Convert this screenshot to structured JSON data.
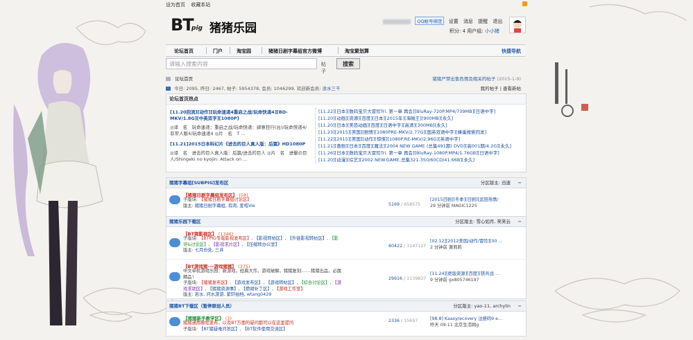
{
  "topbar": {
    "set_home": "设为首页",
    "bookmark": "收藏本站"
  },
  "logo": {
    "bt": "BT",
    "pig": "pig",
    "name": "猪猪乐园"
  },
  "user": {
    "qq_bind": "QQ帐号绑定",
    "links": [
      "设置",
      "消息",
      "提醒",
      "退出"
    ],
    "points": "积分: 4",
    "group_label": "用户组:",
    "group": "小小猪"
  },
  "nav": {
    "items": [
      "论坛首页",
      "门户",
      "淘宝园",
      "猪猪日剧字幕组官方微博",
      "淘宝聚划算"
    ],
    "quick": "快捷导航"
  },
  "search": {
    "placeholder": "请输入搜索内容",
    "type": "帖子",
    "button": "搜索"
  },
  "breadcrumb": {
    "current": "论坛首页",
    "notice": "猪猪严禁出售色情及相关的帖子",
    "notice_date": "(2015-1-9)"
  },
  "stats": {
    "today_label": "今日:",
    "today": "2095",
    "yesterday_label": "昨日:",
    "yesterday": "2467",
    "posts_label": "帖子:",
    "posts": "5954378",
    "members_label": "会员:",
    "members": "1046299",
    "welcome_label": "欢迎新会员:",
    "newest": "浪水三千",
    "my_posts": "我的帖子",
    "new_posts": "查看新帖"
  },
  "hot": {
    "title": "论坛首页热点",
    "left": [
      {
        "title": "[11.20回流][动作][玩命速递4重启之战/玩命快递4][BD-MKV/1.8G][中英双字][1080P]",
        "desc": "◎译　名　玩命速递：重启之战/玩命快递：肆意狂行(台)/玩命快递4/非常人贩4/玩命速递4 ◎片　名　T ..."
      },
      {
        "title": "[11.21]2015日本科幻片《进击的巨人真人版：后篇》HD1080P",
        "desc": "◎译　名　进击的巨人真人版：后篇/进击的巨人 ◎片　名　进擊の巨人/Shingeki no kyojin: Attack on ..."
      }
    ],
    "right": [
      "[11.22][日本][数码宝贝大冒险Tri. 第一章 再会][BluRay-720P.MP4/739MB][日语中字]",
      "[11.20][动画][资源][百度][日本][2015年][海贼王][900MB][永久]",
      "[11.20][日本][美恐动画][百度][日语中字][高清][300MB][永久]",
      "[11.23][2015][美国][剧情][1080PRE-MKV/2.77G][国英双语中字][蜂巢搜索同发]",
      "[11.22][2015][美国][动作][惊悚][1080P.RE-MKV/2.96G][英语中字]",
      "[11.21][喜剧][日本][百度][魔法][2004 NEW GAME (总集491期) DVD][高001期/4.2G][永久]",
      "[11.26][日本][数码宝贝大冒险Tri. 第一章 再会][BluRay-1080P.MP4/1.76GB][日语中字]",
      "[11.20][动漫][综艺][2002.NEW.GAME.总集321-350/60CD/41.66B][永久]"
    ]
  },
  "sections": [
    {
      "title": "猪猪字幕组[SUBPIG]发布区",
      "mod_label": "分区版主:",
      "mod": "迅速",
      "forums": [
        {
          "name": "【猪猪日剧字幕组发布区】",
          "count": "(58)",
          "sub_label": "子版块:",
          "subs": [
            {
              "t": "【猪猪日剧字幕组讨论区】",
              "c": "c1"
            }
          ],
          "new_label": "版主:",
          "new": "猪猪日剧字幕组, 有肉, 爱呱Vie",
          "num": "5169",
          "total": "/ 658575",
          "last": "[2015日剧][冬季][日剧][武田热情/",
          "by": "29 分钟前 MAGIC1225"
        }
      ]
    },
    {
      "title": "猪猪乐园下载区",
      "mod_label": "分区版主:",
      "mod": "雪心如月, 笑笑云",
      "forums": [
        {
          "name": "【BT猪影视区】",
          "count": "(1346)",
          "sub_label": "子版块:",
          "subs": [
            {
              "t": "【BTPIG专版影视发布区】",
              "c": "c1"
            },
            {
              "t": "【影视转帖区】",
              "c": "c2"
            },
            {
              "t": "【外链影视转帖区】",
              "c": "c2"
            },
            {
              "t": "【影评&讨论区】",
              "c": "c3"
            },
            {
              "t": "【影视求片区】",
              "c": "c4"
            },
            {
              "t": "【压缩转办公室】",
              "c": "c2"
            }
          ],
          "new_label": "版主:",
          "new": "七月份处, 三井",
          "num": "60422",
          "total": "/ 3147127",
          "last": "[02.12][2012美国/动作/冒险][00 ...",
          "by": "2 分钟前 萧莉莉"
        },
        {
          "name": "【BT游戏猪·一游戏猪猪】",
          "count": "(375)",
          "sub_label": "子版块:",
          "desc": "中文单机游戏乐园：新游戏，经典大作，游戏破解，猪猪复刻.......猪猪出品，必属精品！",
          "subs": [
            {
              "t": "【猪猪发布区】",
              "c": "c1"
            },
            {
              "t": "【游戏发布区】",
              "c": "c2"
            },
            {
              "t": "【游戏转帖区】",
              "c": "c2"
            },
            {
              "t": "【综合讨论区】",
              "c": "c3"
            },
            {
              "t": "【游戏求助区】",
              "c": "c4"
            },
            {
              "t": "【猪猪资源事】",
              "c": "c2"
            },
            {
              "t": "【攒胡补丁区】",
              "c": "c2"
            },
            {
              "t": "【游戏工作室】",
              "c": "c1"
            }
          ],
          "new_label": "版主:",
          "new": "若水, 问水游游, 紫轩拍档, wtang0429",
          "num": "29916",
          "total": "/ 1139837",
          "last": "[11.24][绝版资源][百度][铁兵战 ...",
          "by": "9 分钟前 gx805746197"
        }
      ]
    },
    {
      "title": "猪猪BT下载区（暂停原创人员）",
      "mod_label": "分区版主:",
      "mod": "yao-11, archylin",
      "forums": [
        {
          "name": "【猪猪新手教学区】",
          "count": "(3)",
          "sub_label": "子版块:",
          "desc": "猪猪通用教程发布，以及BT方面的疑问都可以在这里提问",
          "subs": [
            {
              "t": "【BT猪疑难问答区】",
              "c": "c2"
            },
            {
              "t": "【BT软件使用交流区】",
              "c": "c2"
            }
          ],
          "new_label": "",
          "new": "",
          "num": "2336",
          "total": "/ 15697",
          "last": "[98.8] Kaasyrecovery 注册码9 e...",
          "by": "昨天 09:11 北京生活网g"
        }
      ]
    }
  ]
}
